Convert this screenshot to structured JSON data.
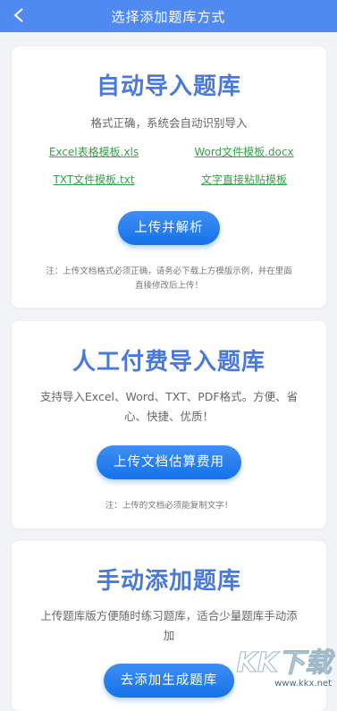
{
  "header": {
    "title": "选择添加题库方式",
    "back_icon": "chevron-left-icon"
  },
  "auto_import": {
    "title": "自动导入题库",
    "subtitle": "格式正确，系统会自动识别导入",
    "links": [
      "Excel表格模板.xls",
      "Word文件模板.docx",
      "TXT文件模板.txt",
      "文字直接粘贴模板"
    ],
    "button": "上传并解析",
    "note_line1": "注：上传文档格式必须正确，请务必下载上方模版示例，并在里面",
    "note_line2": "直接修改后上传！"
  },
  "paid_import": {
    "title": "人工付费导入题库",
    "subtitle_line1": "支持导入Excel、Word、TXT、PDF格式。方便、省",
    "subtitle_line2": "心、快捷、优质！",
    "button": "上传文档估算费用",
    "note": "注：上传的文档必须能复制文字！"
  },
  "manual_add": {
    "title": "手动添加题库",
    "subtitle_line1": "上传题库版方便随时练习题库，适合少量题库手动添",
    "subtitle_line2": "加",
    "button": "去添加生成题库"
  },
  "watermark": {
    "text": "KK下载",
    "url": "www.kkx.net"
  },
  "colors": {
    "header": "#4f8af3",
    "title": "#4a7ad9",
    "link": "#37a04a",
    "button": "#1672e8"
  }
}
